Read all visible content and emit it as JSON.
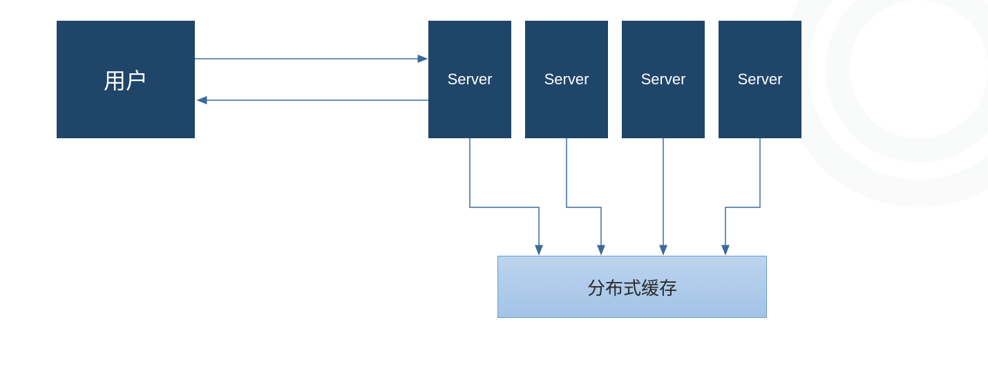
{
  "diagram": {
    "user_label": "用户",
    "servers": {
      "s1": "Server",
      "s2": "Server",
      "s3": "Server",
      "s4": "Server"
    },
    "cache_label": "分布式缓存"
  },
  "colors": {
    "box_dark": "#1f4569",
    "box_light": "#a3c3e7",
    "line": "#3c6a9a",
    "arrow": "#3c6a9a"
  }
}
